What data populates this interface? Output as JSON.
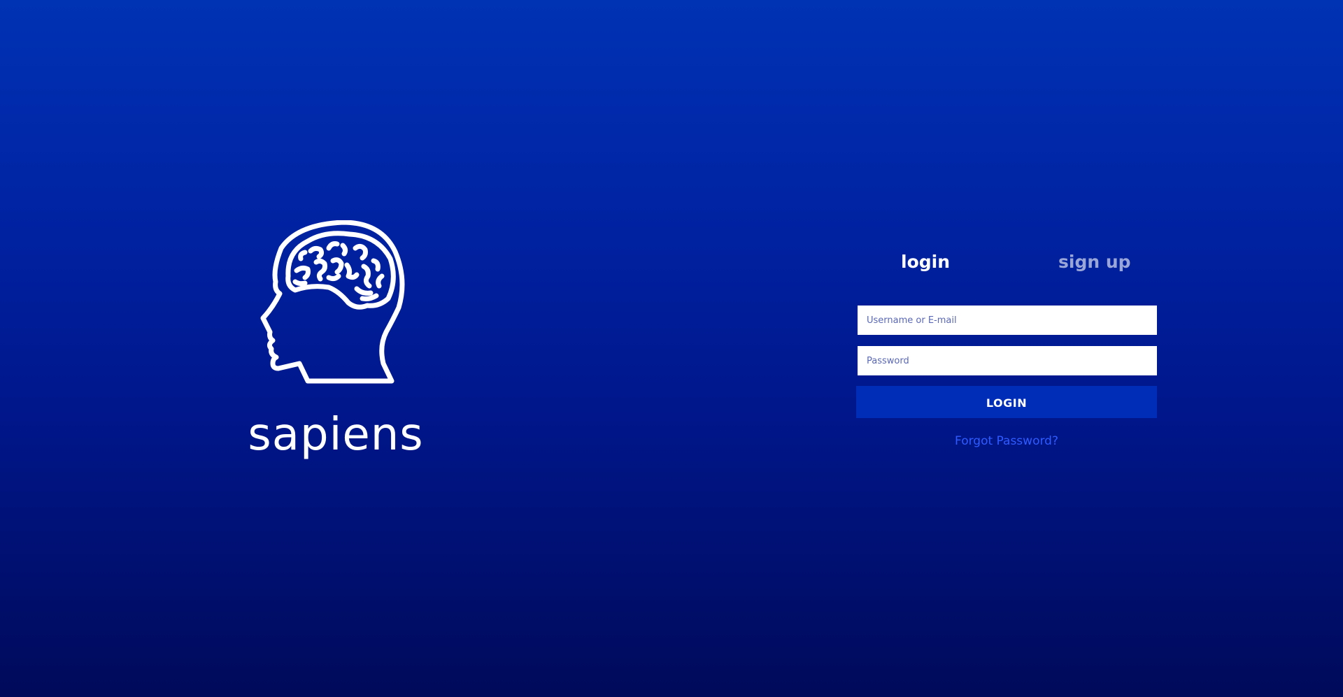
{
  "brand": {
    "logo_icon": "brain-head-icon",
    "name": "sapiens"
  },
  "tabs": {
    "login_label": "login",
    "signup_label": "sign up",
    "active": "login"
  },
  "form": {
    "username_placeholder": "Username or E-mail",
    "username_value": "",
    "password_placeholder": "Password",
    "password_value": "",
    "login_button_label": "LOGIN",
    "forgot_password_link": "Forgot Password?"
  },
  "colors": {
    "background_top": "#0032b4",
    "background_bottom": "#000a5a",
    "button": "#002db8",
    "link": "#2f5bff",
    "inactive_tab": "#9aa6d8"
  }
}
